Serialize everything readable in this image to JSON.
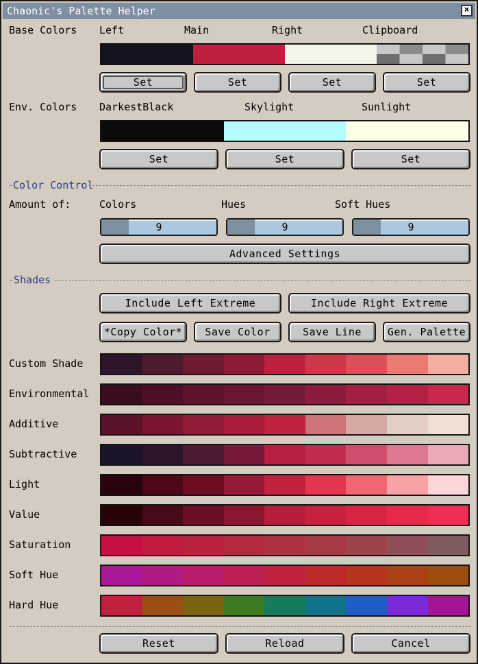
{
  "window": {
    "title": "Chaonic's Palette Helper",
    "close_glyph": "×"
  },
  "base": {
    "label": "Base Colors",
    "columns": [
      "Left",
      "Main",
      "Right",
      "Clipboard"
    ],
    "swatches": [
      "#14121f",
      "#c0203f",
      "#f5f5e8"
    ],
    "set_label": "Set"
  },
  "env": {
    "label": "Env. Colors",
    "columns": [
      "DarkestBlack",
      "Skylight",
      "Sunlight"
    ],
    "swatches": [
      "#0b0b0b",
      "#b3fbff",
      "#feffe6"
    ],
    "set_label": "Set"
  },
  "color_control": {
    "section": "Color Control",
    "amount_label": "Amount of:",
    "sliders": [
      {
        "label": "Colors",
        "value": "9"
      },
      {
        "label": "Hues",
        "value": "9"
      },
      {
        "label": "Soft Hues",
        "value": "9"
      }
    ],
    "advanced_label": "Advanced Settings"
  },
  "shades": {
    "section": "Shades",
    "include_left": "Include Left Extreme",
    "include_right": "Include Right Extreme",
    "copy_color": "*Copy Color*",
    "save_color": "Save Color",
    "save_line": "Save Line",
    "gen_palette": "Gen. Palette",
    "rows": [
      {
        "label": "Custom Shade",
        "colors": [
          "#2e1529",
          "#4e1a2e",
          "#6e1b31",
          "#8e1b36",
          "#bd213f",
          "#d0384a",
          "#de5058",
          "#ea7a72",
          "#f2afa0"
        ]
      },
      {
        "label": "Environmental",
        "colors": [
          "#3a0d20",
          "#4e1028",
          "#5f122b",
          "#6a1532",
          "#761a3a",
          "#8c1c3b",
          "#a11f40",
          "#b52044",
          "#c9284c"
        ]
      },
      {
        "label": "Additive",
        "colors": [
          "#5c1228",
          "#7a1631",
          "#941b38",
          "#a91c3b",
          "#c0223f",
          "#cd7478",
          "#d8a8a4",
          "#e4cfc6",
          "#eee0d4"
        ]
      },
      {
        "label": "Subtractive",
        "colors": [
          "#1c1528",
          "#2d162c",
          "#4d1a33",
          "#77193a",
          "#b61f40",
          "#c42c4d",
          "#d04f6c",
          "#dc7890",
          "#e9a8b6"
        ]
      },
      {
        "label": "Light",
        "colors": [
          "#2a030c",
          "#4c0818",
          "#6d0d22",
          "#961a36",
          "#c2223f",
          "#e43650",
          "#f06673",
          "#f8a1a6",
          "#fdd5d6"
        ]
      },
      {
        "label": "Value",
        "colors": [
          "#280408",
          "#470a18",
          "#6a0f24",
          "#8c1630",
          "#b81e3c",
          "#c8213f",
          "#d82546",
          "#e6294c",
          "#f02d54"
        ]
      },
      {
        "label": "Saturation",
        "colors": [
          "#c71041",
          "#c11a3f",
          "#bc223f",
          "#b62a41",
          "#b03242",
          "#a83946",
          "#9c444c",
          "#8e5056",
          "#805c5e"
        ]
      },
      {
        "label": "Soft Hue",
        "colors": [
          "#a9189a",
          "#b01a84",
          "#b81c6a",
          "#bd1e54",
          "#c0213f",
          "#bd2a2a",
          "#b6351d",
          "#ab4115",
          "#9c4d10"
        ]
      },
      {
        "label": "Hard Hue",
        "colors": [
          "#c0213f",
          "#9a4f14",
          "#7a6414",
          "#3e7a20",
          "#167a5c",
          "#13738a",
          "#1e5ec8",
          "#7a2ad8",
          "#a31496"
        ]
      }
    ]
  },
  "footer": {
    "reset": "Reset",
    "reload": "Reload",
    "cancel": "Cancel"
  }
}
